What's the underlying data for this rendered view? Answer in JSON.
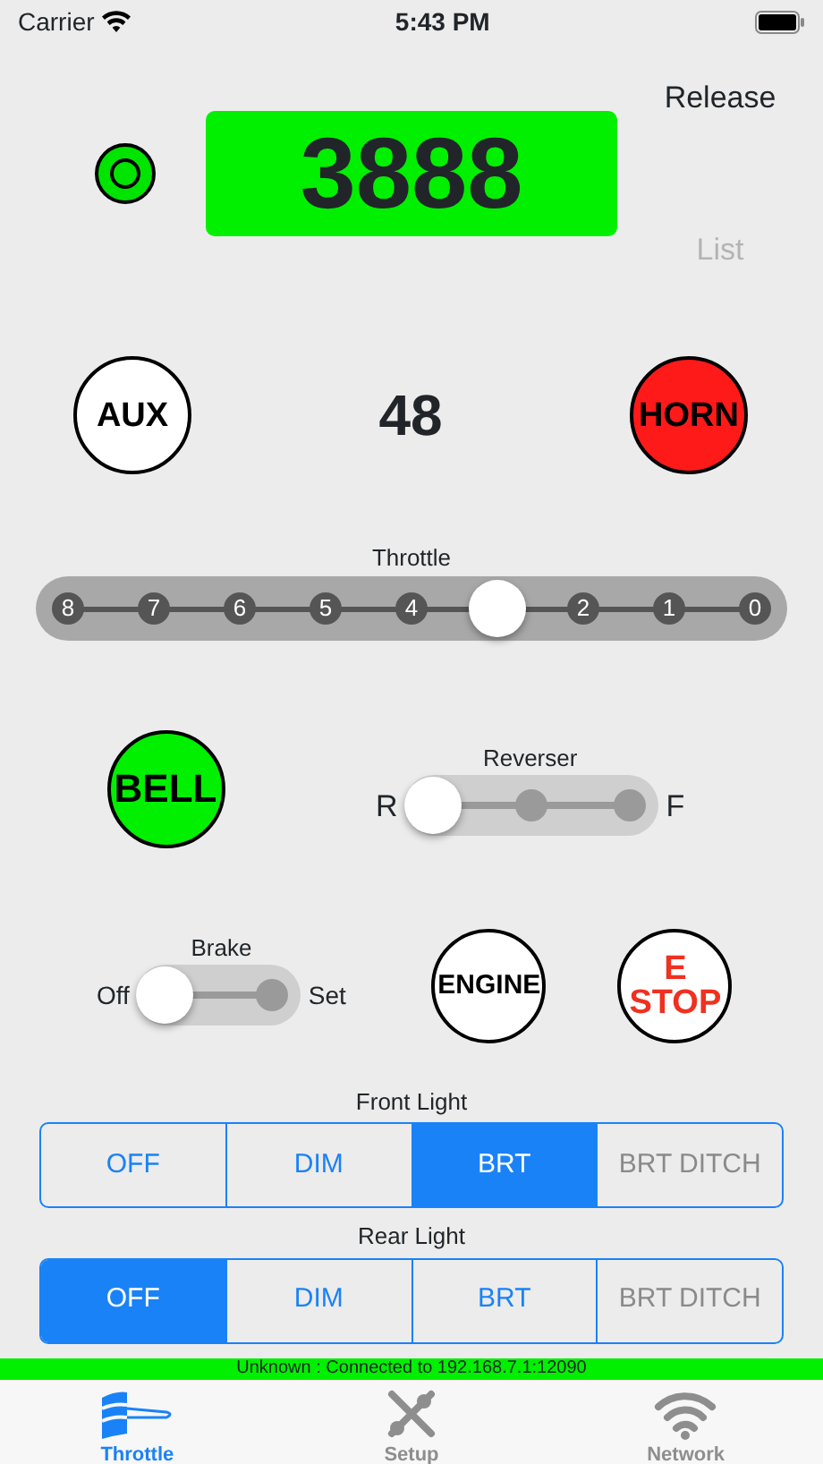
{
  "status_bar": {
    "carrier": "Carrier",
    "time": "5:43 PM"
  },
  "address": {
    "indicator_on": true,
    "number": "3888",
    "release": "Release",
    "list": "List",
    "list_disabled": true
  },
  "function_row": {
    "aux": {
      "label": "AUX",
      "on": false
    },
    "speed": "48",
    "horn": {
      "label": "HORN",
      "on": true
    }
  },
  "throttle": {
    "label": "Throttle",
    "stops": [
      "8",
      "7",
      "6",
      "5",
      "4",
      "2",
      "1",
      "0"
    ],
    "level": 0.625
  },
  "bell": {
    "label": "BELL",
    "on": true
  },
  "reverser": {
    "label": "Reverser",
    "left": "R",
    "right": "F",
    "level": 0
  },
  "brake": {
    "label": "Brake",
    "left": "Off",
    "right": "Set",
    "on": false
  },
  "engine": {
    "label": "ENGINE",
    "on": false
  },
  "estop": {
    "label": "E STOP"
  },
  "lights": [
    {
      "label": "Front Light",
      "options": [
        {
          "label": "OFF",
          "selected": false,
          "disabled": false
        },
        {
          "label": "DIM",
          "selected": false,
          "disabled": false
        },
        {
          "label": "BRT",
          "selected": true,
          "disabled": false
        },
        {
          "label": "BRT DITCH",
          "selected": false,
          "disabled": true
        }
      ]
    },
    {
      "label": "Rear Light",
      "options": [
        {
          "label": "OFF",
          "selected": true,
          "disabled": false
        },
        {
          "label": "DIM",
          "selected": false,
          "disabled": false
        },
        {
          "label": "BRT",
          "selected": false,
          "disabled": false
        },
        {
          "label": "BRT DITCH",
          "selected": false,
          "disabled": true
        }
      ]
    }
  ],
  "connection": {
    "text": "Unknown : Connected to 192.168.7.1:12090",
    "connected": true
  },
  "tabs": [
    {
      "label": "Throttle",
      "kind": "throttle",
      "selected": true
    },
    {
      "label": "Setup",
      "kind": "setup",
      "selected": false
    },
    {
      "label": "Network",
      "kind": "network",
      "selected": false
    }
  ]
}
